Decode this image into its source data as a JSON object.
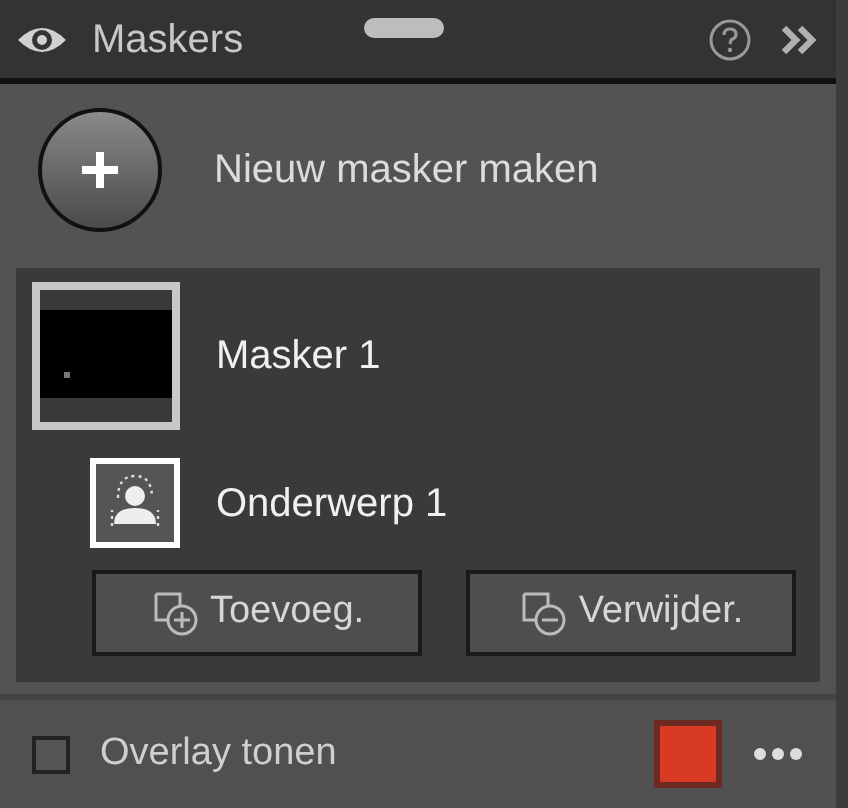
{
  "panel": {
    "title": "Maskers"
  },
  "create": {
    "label": "Nieuw masker maken"
  },
  "masks": [
    {
      "name": "Masker 1",
      "selected": true,
      "components": [
        {
          "name": "Onderwerp 1",
          "selected": true
        }
      ]
    }
  ],
  "actions": [
    {
      "kind": "add",
      "label": "Toevoeg."
    },
    {
      "kind": "remove",
      "label": "Verwijder."
    }
  ],
  "overlay": {
    "label": "Overlay tonen",
    "checked": false,
    "color": "#d93a23"
  }
}
